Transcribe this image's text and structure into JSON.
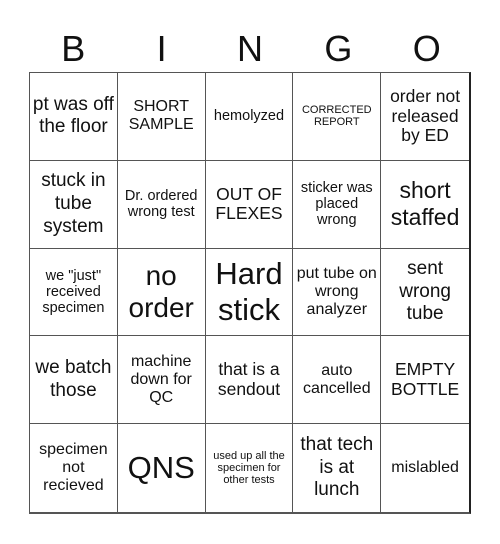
{
  "header": {
    "letters": [
      "B",
      "I",
      "N",
      "G",
      "O"
    ]
  },
  "cells": [
    "pt was off the floor",
    "SHORT SAMPLE",
    "hemolyzed",
    "CORRECTED REPORT",
    "order not released by ED",
    "stuck in tube system",
    "Dr. ordered wrong test",
    "OUT OF FLEXES",
    "sticker was placed wrong",
    "short staffed",
    "we \"just\" received specimen",
    "no order",
    "Hard stick",
    "put tube on wrong analyzer",
    "sent wrong tube",
    "we batch those",
    "machine down for QC",
    "that is a sendout",
    "auto cancelled",
    "EMPTY BOTTLE",
    "specimen not recieved",
    "QNS",
    "used up all the specimen for other tests",
    "that tech is at lunch",
    "mislabled"
  ]
}
